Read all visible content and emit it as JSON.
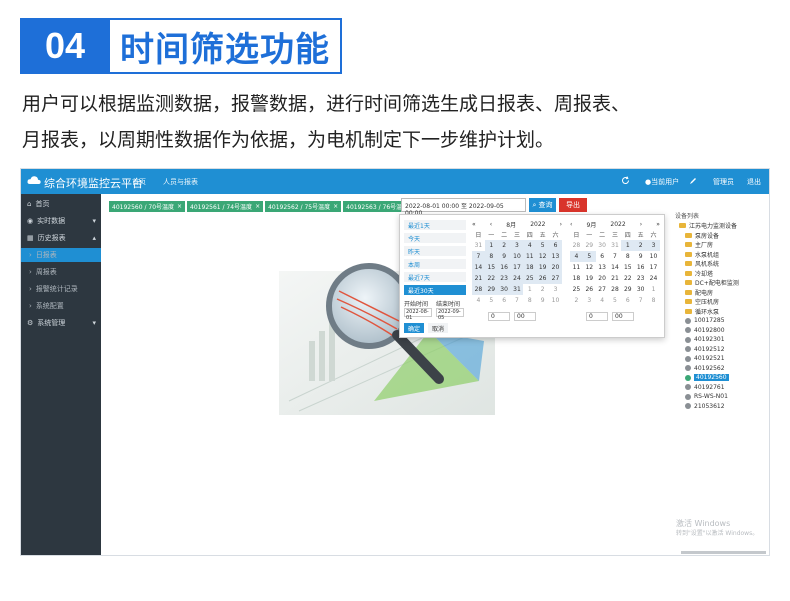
{
  "heading": {
    "number": "04",
    "title": "时间筛选功能"
  },
  "description": {
    "line1": "用户可以根据监测数据，报警数据，进行时间筛选生成日报表、周报表、",
    "line2": "月报表，以周期性数据作为依据，为电机制定下一步维护计划。"
  },
  "app": {
    "title": "综合环境监控云平台",
    "nav": [
      "首页",
      "人员与报表"
    ],
    "topbar_right": [
      "●当前用户",
      "管理员",
      "退出"
    ],
    "sidebar": [
      {
        "label": "首页"
      },
      {
        "label": "实时数据"
      },
      {
        "label": "历史报表"
      },
      {
        "label": "日报表"
      },
      {
        "label": "周报表"
      },
      {
        "label": "报警统计记录"
      },
      {
        "label": "系统配置"
      },
      {
        "label": "系统管理"
      }
    ],
    "tags": [
      "40192560 / 70号温度",
      "40192561 / 74号温度",
      "40192562 / 75号温度",
      "40192563 / 76号温度"
    ],
    "range_value": "2022-08-01 00:00 至 2022-09-05 00:00",
    "buttons": {
      "query": "查询",
      "export": "导出"
    },
    "picker": {
      "presets": [
        "最近1天",
        "今天",
        "昨天",
        "本周",
        "最近7天",
        "最近30天"
      ],
      "start_label": "开始时间",
      "end_label": "结束时间",
      "start_value": "2022-08-01",
      "end_value": "2022-09-05",
      "confirm": "确定",
      "cancel": "取消",
      "left_month": "8月",
      "left_year": "2022",
      "right_month": "9月",
      "right_year": "2022",
      "hour_left": "0",
      "minute_left": "00",
      "hour_right": "0",
      "minute_right": "00",
      "weekdays": [
        "日",
        "一",
        "二",
        "三",
        "四",
        "五",
        "六"
      ]
    },
    "tree": {
      "header": "设备列表",
      "root": "江苏电力监测设备",
      "folders": [
        "泵房设备",
        "主厂房",
        "水泵机组",
        "风机系统",
        "冷却塔",
        "DC+配电柜监测",
        "配电房",
        "空压机房",
        "循环水泵"
      ],
      "devices": [
        "10017285",
        "40192800",
        "40192301",
        "40192512",
        "40192521",
        "40192562",
        "40192560",
        "40192761",
        "RS-WS-N01",
        "21053612"
      ]
    },
    "watermark": [
      "激活 Windows",
      "转到\"设置\"以激活 Windows。"
    ]
  },
  "colors": {
    "accent": "#1e6fd8",
    "app_blue": "#1f8fd3",
    "sidebar": "#2d3740",
    "tag_green": "#3aa776",
    "danger": "#d9342b"
  }
}
